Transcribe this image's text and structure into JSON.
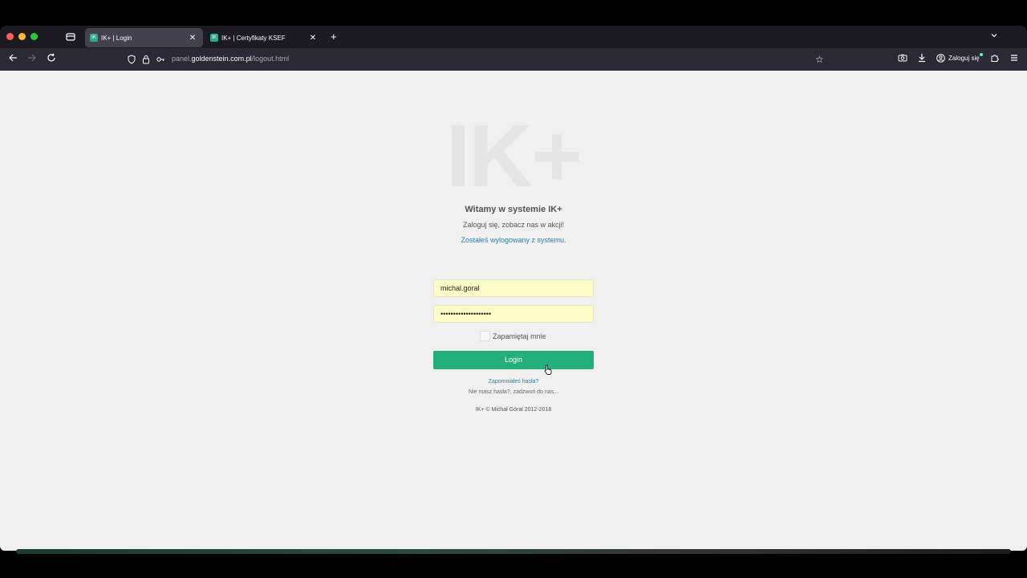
{
  "browser": {
    "tabs": [
      {
        "title": "IK+ | Login",
        "favicon": "IK",
        "active": true
      },
      {
        "title": "IK+ | Certyfikaty KSEF",
        "favicon": "IK",
        "active": false
      }
    ],
    "url": {
      "prefix": "panel.",
      "domain": "goldenstein.com.pl",
      "path": "/logout.html"
    },
    "account_label": "Zaloguj się"
  },
  "login": {
    "logo": "IK+",
    "welcome": "Witamy w systemie IK+",
    "subtitle": "Zaloguj się, zobacz nas w akcji!",
    "logout_message": "Zostałeś wylogowany z systemu.",
    "username_value": "michal.goral",
    "password_value": "••••••••••••••••••••",
    "remember_label": "Zapamiętaj mnie",
    "remember_checked": false,
    "login_button": "Login",
    "forgot_link": "Zapomniałeś hasła?",
    "no_password_text": "Nie masz hasła?, zadzwoń do nas...",
    "copyright": "IK+ © Michał Góral 2012-2018"
  },
  "colors": {
    "accent": "#23b07d",
    "link": "#2a7fa8",
    "field_bg": "#fdfdc7"
  }
}
